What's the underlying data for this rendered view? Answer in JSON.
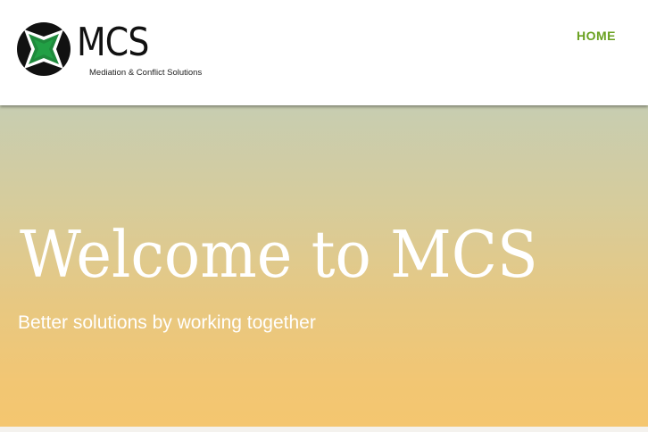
{
  "header": {
    "logo": {
      "wordmark": "MCS",
      "tagline": "Mediation & Conflict Solutions",
      "icon": "mcs-logo-icon"
    },
    "nav": [
      {
        "label": "HOME",
        "active": true
      }
    ]
  },
  "hero": {
    "title": "Welcome to MCS",
    "subtitle": "Better solutions by working together"
  },
  "colors": {
    "nav_accent": "#6aa120",
    "logo_green": "#1f8a3c",
    "hero_top": "#c7cdb1",
    "hero_bottom": "#f4c66f",
    "hero_text": "#ffffff"
  }
}
